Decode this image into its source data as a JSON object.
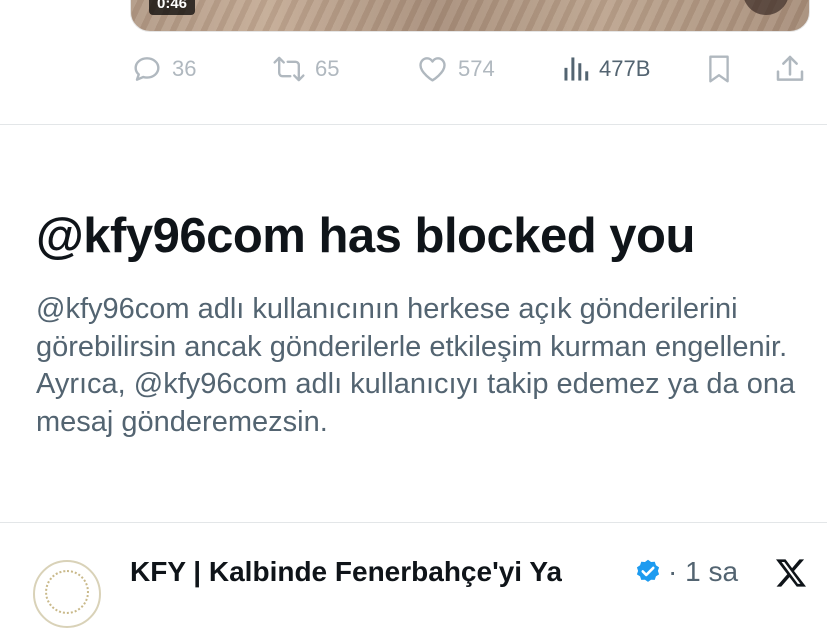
{
  "media": {
    "duration": "0:46"
  },
  "actions": {
    "replies": "36",
    "retweets": "65",
    "likes": "574",
    "views": "477B"
  },
  "block_notice": {
    "title": "@kfy96com has blocked you",
    "description": "@kfy96com adlı kullanıcının herkese açık gönderilerini görebilirsin ancak gönderilerle etkileşim kurman engellenir. Ayrıca, @kfy96com adlı kullanıcıyı takip edemez ya da ona mesaj gönderemezsin."
  },
  "next_tweet": {
    "author_name": "KFY | Kalbinde Fenerbahçe'yi Ya",
    "time": "· 1 sa"
  },
  "colors": {
    "text_primary": "#0f1419",
    "text_secondary": "#536471",
    "icon_muted": "#b0b8bf",
    "verified_blue": "#1d9bf0",
    "divider": "#e3e6e8"
  },
  "icons": [
    "reply-icon",
    "retweet-icon",
    "like-icon",
    "views-icon",
    "bookmark-icon",
    "share-icon",
    "verified-badge-icon",
    "x-logo-icon"
  ]
}
